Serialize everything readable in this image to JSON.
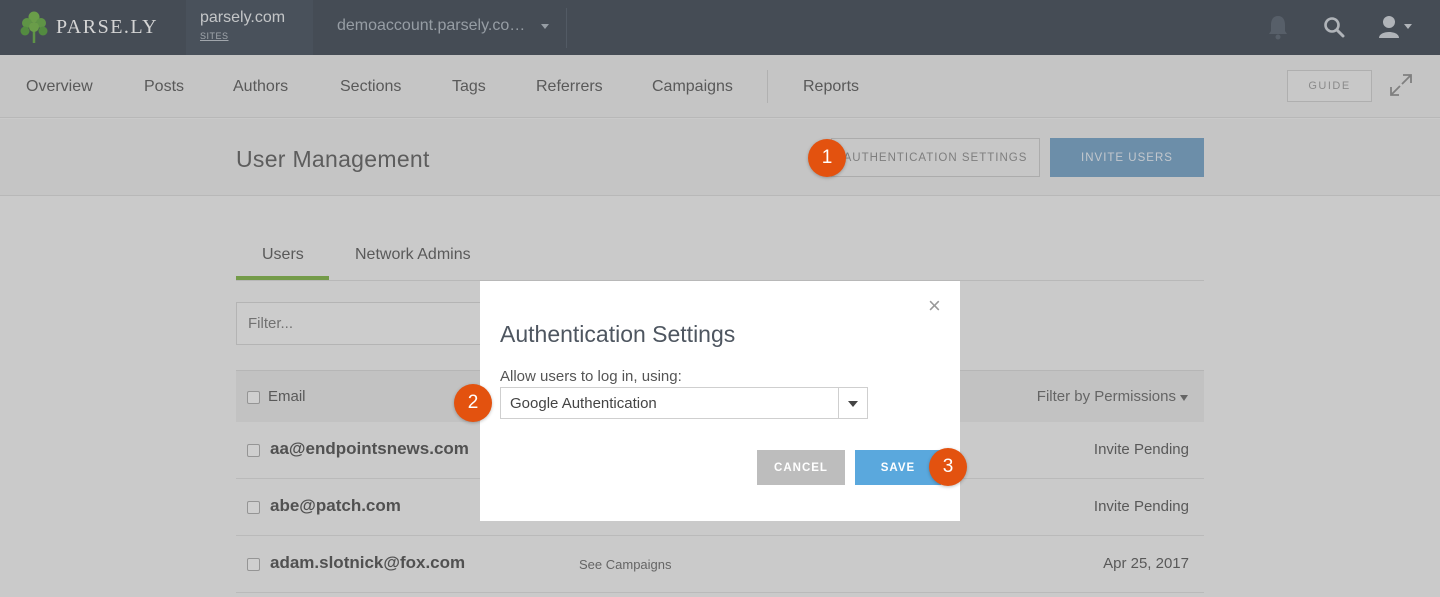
{
  "topbar": {
    "logo_text": "PARSE.LY",
    "site_name": "parsely.com",
    "site_sub": "SITES",
    "account": "demoaccount.parsely.co…"
  },
  "nav": {
    "items": [
      "Overview",
      "Posts",
      "Authors",
      "Sections",
      "Tags",
      "Referrers",
      "Campaigns",
      "Reports"
    ],
    "guide_label": "GUIDE"
  },
  "header": {
    "title": "User Management",
    "auth_settings_label": "AUTHENTICATION SETTINGS",
    "invite_label": "INVITE USERS"
  },
  "tabs": [
    "Users",
    "Network Admins"
  ],
  "filter": {
    "placeholder": "Filter..."
  },
  "table": {
    "email_header": "Email",
    "permissions_header": "Filter by Permissions",
    "rows": [
      {
        "email": "aa@endpointsnews.com",
        "mid": "",
        "status": "Invite Pending"
      },
      {
        "email": "abe@patch.com",
        "mid": "",
        "status": "Invite Pending"
      },
      {
        "email": "adam.slotnick@fox.com",
        "mid": "See Campaigns",
        "status": "Apr 25, 2017"
      }
    ]
  },
  "modal": {
    "close": "×",
    "title": "Authentication Settings",
    "label": "Allow users to log in, using:",
    "selected": "Google Authentication",
    "cancel_label": "CANCEL",
    "save_label": "SAVE"
  },
  "badges": [
    "1",
    "2",
    "3"
  ],
  "colors": {
    "topbar": "#394350",
    "accent_green": "#7ab03f",
    "save_blue": "#5aa8dd",
    "badge_orange": "#e3520f"
  }
}
